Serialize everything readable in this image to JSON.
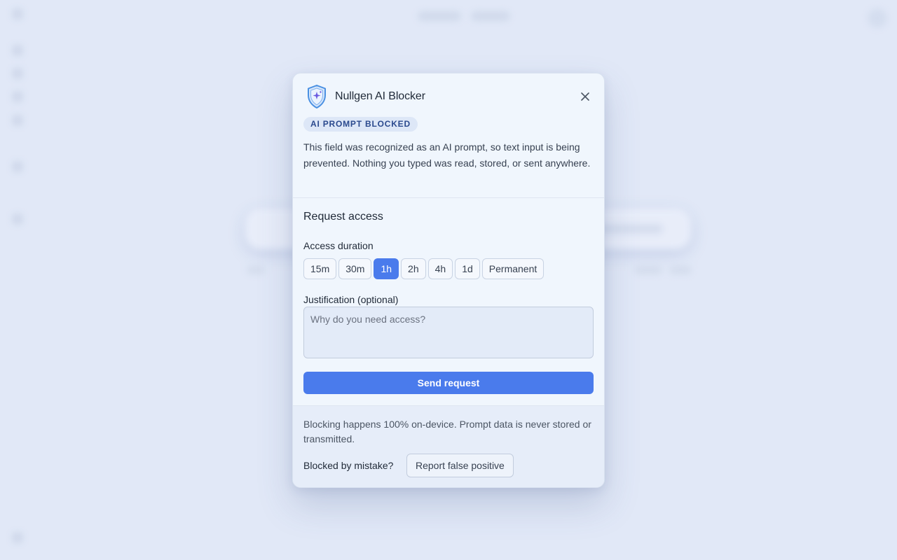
{
  "dialog": {
    "app_name": "Nullgen AI Blocker",
    "logo_icon": "shield-sparkle-icon",
    "close_icon": "close-icon",
    "badge": "AI PROMPT BLOCKED",
    "description": "This field was recognized as an AI prompt, so text input is being prevented. Nothing you typed was read, stored, or sent anywhere."
  },
  "request": {
    "title": "Request access",
    "duration_label": "Access duration",
    "durations": [
      "15m",
      "30m",
      "1h",
      "2h",
      "4h",
      "1d",
      "Permanent"
    ],
    "selected_duration": "1h",
    "justification_label": "Justification (optional)",
    "justification_placeholder": "Why do you need access?",
    "justification_value": "",
    "send_label": "Send request"
  },
  "footer": {
    "privacy": "Blocking happens 100% on-device. Prompt data is never stored or transmitted.",
    "mistake_label": "Blocked by mistake?",
    "report_label": "Report false positive"
  },
  "colors": {
    "accent": "#4a7bec",
    "badge_bg": "#dde7f7",
    "badge_text": "#2b4a8e",
    "backdrop": "#e1e8f7"
  }
}
